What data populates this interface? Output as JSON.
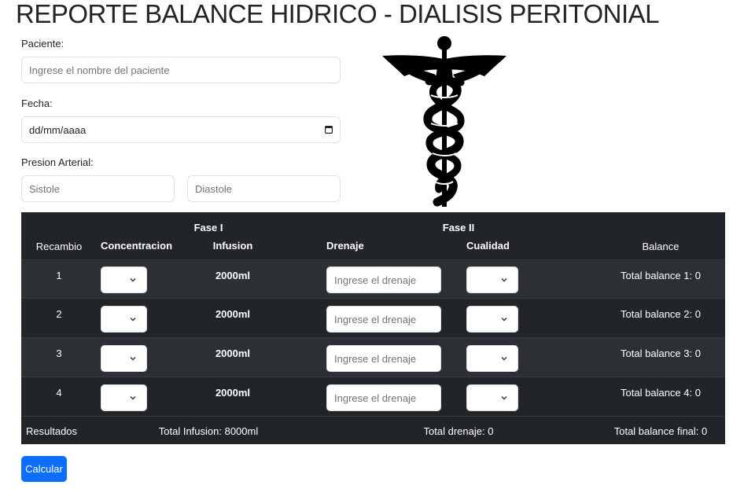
{
  "title": "REPORTE BALANCE HIDRICO - DIALISIS PERITONIAL",
  "form": {
    "patient_label": "Paciente:",
    "patient_placeholder": "Ingrese el nombre del paciente",
    "date_label": "Fecha:",
    "date_placeholder": "dd/mm/aaaa",
    "bp_label": "Presion Arterial:",
    "systolic_placeholder": "Sistole",
    "diastolic_placeholder": "Diastole"
  },
  "logo_icon": "caduceus-icon",
  "table": {
    "phase1": "Fase I",
    "phase2": "Fase II",
    "col_recambio": "Recambio",
    "col_concentracion": "Concentracion",
    "col_infusion": "Infusion",
    "col_drenaje": "Drenaje",
    "col_cualidad": "Cualidad",
    "col_balance": "Balance",
    "rows": [
      {
        "n": "1",
        "infusion": "2000ml",
        "drain_placeholder": "Ingrese el drenaje",
        "balance": "Total balance 1: 0"
      },
      {
        "n": "2",
        "infusion": "2000ml",
        "drain_placeholder": "Ingrese el drenaje",
        "balance": "Total balance 2: 0"
      },
      {
        "n": "3",
        "infusion": "2000ml",
        "drain_placeholder": "Ingrese el drenaje",
        "balance": "Total balance 3: 0"
      },
      {
        "n": "4",
        "infusion": "2000ml",
        "drain_placeholder": "Ingrese el drenaje",
        "balance": "Total balance 4: 0"
      }
    ],
    "results_label": "Resultados",
    "total_infusion": "Total Infusion: 8000ml",
    "total_drenaje": "Total drenaje: 0",
    "total_balance_final": "Total balance final: 0"
  },
  "calc_button": "Calcular",
  "colors": {
    "primary": "#0d6efd",
    "table_dark": "#212529",
    "table_stripe": "#2c3034"
  }
}
